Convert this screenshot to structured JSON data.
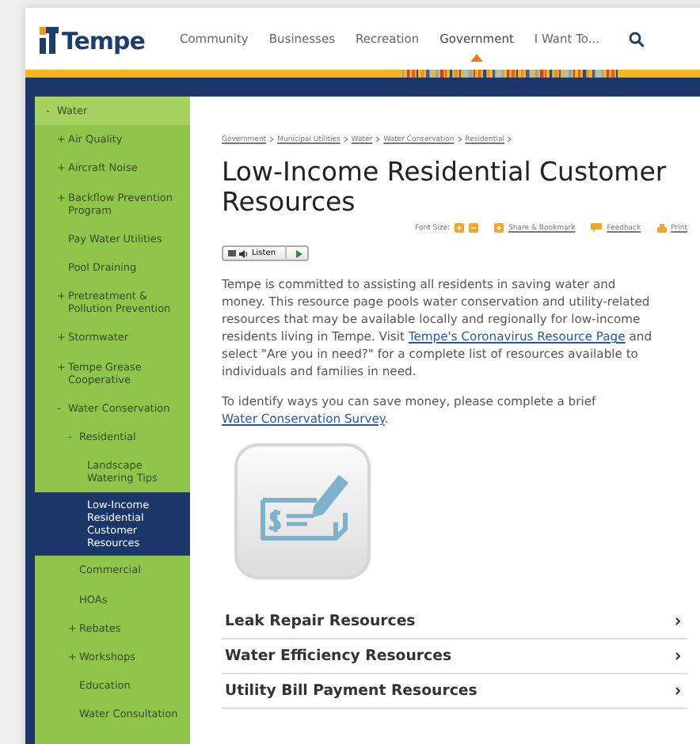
{
  "header": {
    "logo": "Tempe",
    "nav": [
      {
        "label": "Community",
        "selected": false
      },
      {
        "label": "Businesses",
        "selected": false
      },
      {
        "label": "Recreation",
        "selected": false
      },
      {
        "label": "Government",
        "selected": true
      },
      {
        "label": "I Want To...",
        "selected": false
      }
    ]
  },
  "sidebar": {
    "items": [
      {
        "label": "Water",
        "marker": "-",
        "selected": false,
        "children": [
          {
            "label": "Air Quality",
            "marker": "+",
            "selected": false
          },
          {
            "label": "Aircraft Noise",
            "marker": "+",
            "selected": false
          },
          {
            "label": "Backflow Prevention Program",
            "marker": "+",
            "selected": false
          },
          {
            "label": "Pay Water Utilities",
            "selected": false
          },
          {
            "label": "Pool Draining",
            "selected": false
          },
          {
            "label": "Pretreatment & Pollution Prevention",
            "marker": "+",
            "selected": false
          },
          {
            "label": "Stormwater",
            "marker": "+",
            "selected": false
          },
          {
            "label": "Tempe Grease Cooperative",
            "marker": "+",
            "selected": false
          },
          {
            "label": "Water Conservation",
            "marker": "-",
            "selected": false,
            "children": [
              {
                "label": "Residential",
                "marker": "-",
                "selected": false,
                "children": [
                  {
                    "label": "Landscape Watering Tips",
                    "selected": false
                  },
                  {
                    "label": "Low-Income Residential Customer Resources",
                    "selected": true
                  }
                ]
              },
              {
                "label": "Commercial",
                "selected": false
              },
              {
                "label": "HOAs",
                "selected": false
              },
              {
                "label": "Rebates",
                "marker": "+",
                "selected": false
              },
              {
                "label": "Workshops",
                "marker": "+",
                "selected": false
              },
              {
                "label": "Education",
                "selected": false
              },
              {
                "label": "Water Consultation",
                "selected": false
              }
            ]
          }
        ]
      }
    ]
  },
  "breadcrumb": [
    "Government",
    "Municipal Utilities",
    "Water",
    "Water Conservation",
    "Residential"
  ],
  "title": "Low-Income Residential Customer Resources",
  "tools": {
    "font_size_label": "Font Size:",
    "share": "Share & Bookmark",
    "feedback": "Feedback",
    "print": "Print"
  },
  "listen": "Listen",
  "paragraphs": [
    [
      {
        "text": "Tempe is committed to assisting all residents in saving water and money.  This resource page pools water conservation and utility-related resources that may be available locally and regionally for low-income residents living in Tempe.  Visit "
      },
      {
        "link": "Tempe's Coronavirus Resource Page"
      },
      {
        "text": " and select \"Are you in need?\" for a complete list of resources available to individuals and families in need."
      }
    ],
    [
      {
        "text": "To identify ways you can save money, please complete a brief "
      },
      {
        "link": "Water Conservation Survey"
      },
      {
        "text": "."
      }
    ]
  ],
  "accordions": [
    {
      "label": "Leak Repair Resources",
      "expanded": false
    },
    {
      "label": "Water Efficiency Resources",
      "expanded": false
    },
    {
      "label": "Utility Bill Payment Resources",
      "expanded": false
    }
  ]
}
